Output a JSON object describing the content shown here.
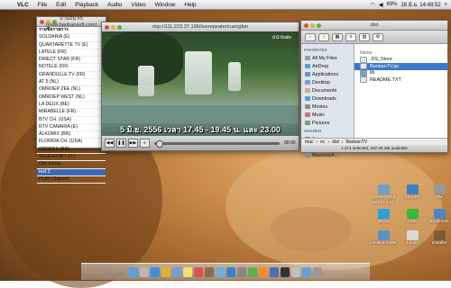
{
  "menubar": {
    "app_name": "VLC",
    "items": [
      "File",
      "Edit",
      "Playback",
      "Audio",
      "Video",
      "Window",
      "Help"
    ],
    "status": {
      "battery": "69%",
      "clock": "28 มิ.ย. 14:48:52"
    }
  },
  "playlist": {
    "title": "บ้านบัน #5 (www.banbansoft.com)",
    "items": [
      "รายชื่อรายการ",
      "SOLDARIA (E)",
      "QUARTARETTE TV (E)",
      "LATELE (FR)",
      "DIRECT STAR (FR)",
      "NOTELE (FR)",
      "GRANDULLE TV (FR)",
      "AT 5 (NL)",
      "OMROEP ZEE (NL)",
      "OMROEP WEST (NL)",
      "LA DEUX (BE)",
      "MIRABELLE (FR)",
      "BTV CH. (USA)",
      "RTV CANARIA (E)",
      "ALKOMIX (BR)",
      "FLORIDA CH. (USA)",
      "SPORT 5 (BR)",
      "TELESPORT (IT)",
      "Cbs korea",
      "test 2",
      "PLAY Channel"
    ],
    "selected_index": 19
  },
  "video": {
    "title": "rtsp://111.223.37.196/liverepeater/ruengfan",
    "subtitle": "5 มิ.ย. 2556 เวลา 17.45 - 19.45 น. และ 23.00",
    "logo": "ch3 thaitv",
    "time": "00:00"
  },
  "finder": {
    "title": "dist",
    "sidebar": {
      "favorites_header": "FAVORITES",
      "favorites": [
        "All My Files",
        "AirDrop",
        "Applications",
        "Desktop",
        "Documents",
        "Downloads",
        "Movies",
        "Music",
        "Pictures"
      ],
      "shared_header": "SHARED",
      "shared": [
        "thippy-pc"
      ],
      "devices_header": "DEVICES",
      "devices": [
        "Macintosh..."
      ]
    },
    "column_header": "Name",
    "files": [
      {
        "name": ".DS_Store",
        "selected": false
      },
      {
        "name": "BanbanTV.jar",
        "selected": true
      },
      {
        "name": "lib",
        "selected": false
      },
      {
        "name": "README.TXT",
        "selected": false
      }
    ],
    "path": [
      "mac",
      "ec",
      "dist",
      "BanbanTV"
    ],
    "status": "1 of 4 selected, 187.06 GB available"
  },
  "desktop_icons": [
    {
      "label": "Screen Shot 2013...4.51",
      "color": "#6fa0c8"
    },
    {
      "label": "Keygen",
      "color": "#3d7fc6"
    },
    {
      "label": "SM",
      "color": "#9a9a9a"
    },
    {
      "label": "Skype",
      "color": "#2aa0e0"
    },
    {
      "label": "LINE",
      "color": "#2fbb3b"
    },
    {
      "label": "Bookmark",
      "color": "#4b86c6"
    },
    {
      "label": "Untitled folder",
      "color": "#5b93c9"
    },
    {
      "label": "Jumsri",
      "color": "#d9d9d9"
    },
    {
      "label": "Installer",
      "color": "#7a5c3a"
    }
  ],
  "dock_icons": [
    "finder-icon",
    "launchpad-icon",
    "safari-icon",
    "chrome-icon",
    "mail-icon",
    "notes-icon",
    "calendar-icon",
    "photos-icon",
    "itunes-icon",
    "appstore-icon",
    "preferences-icon",
    "utorrent-icon",
    "vlc-icon",
    "xcode-icon",
    "terminal-icon",
    "preview-icon",
    "downloads-icon",
    "trash-icon"
  ]
}
